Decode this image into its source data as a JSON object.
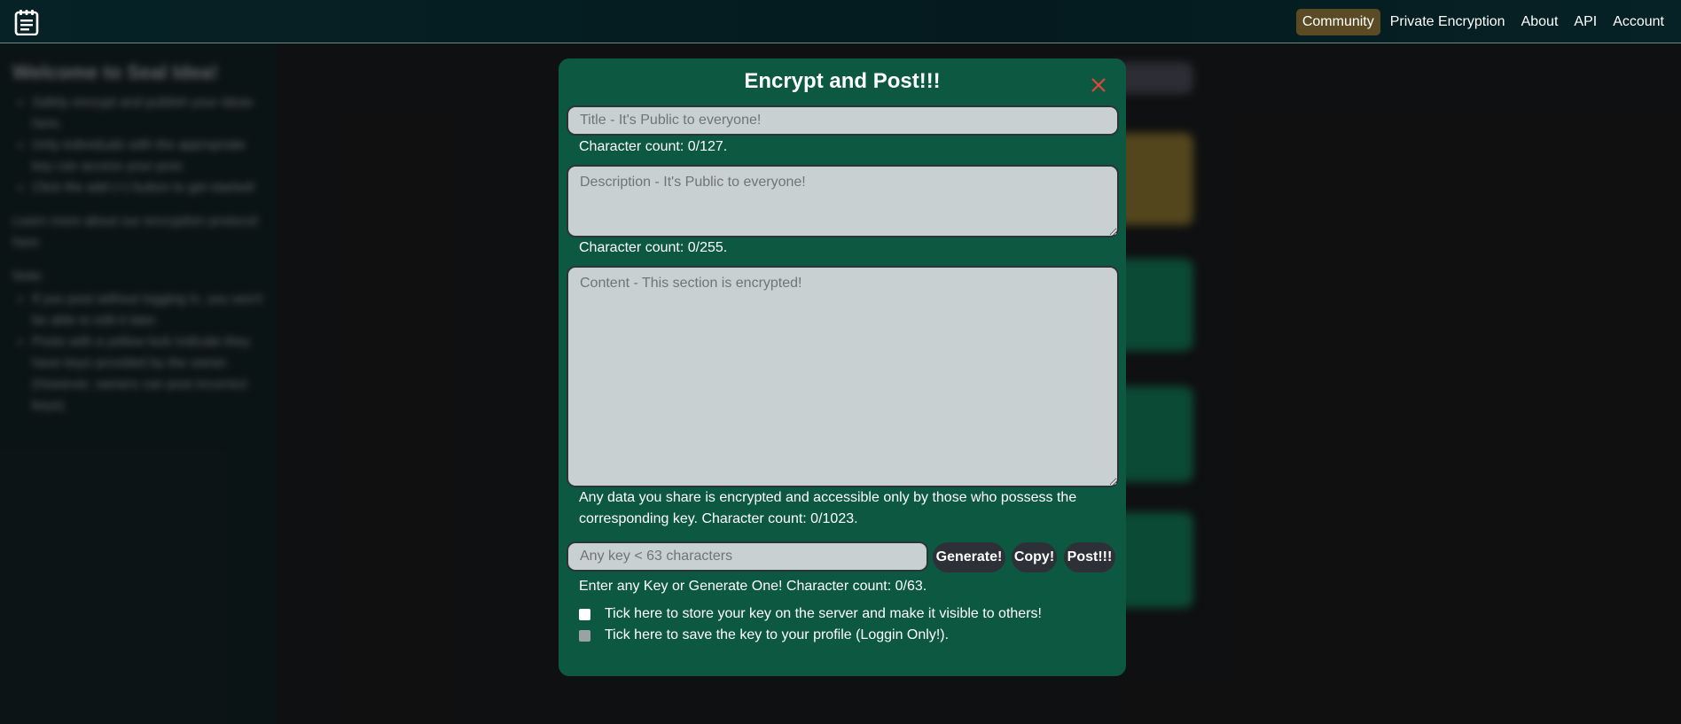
{
  "nav": {
    "links": [
      "Community",
      "Private Encryption",
      "About",
      "API",
      "Account"
    ],
    "active": "Community"
  },
  "sidebar": {
    "heading": "Welcome to Seal Idea!",
    "bullets": [
      "Safely encrypt and publish your ideas here.",
      "Only individuals with the appropriate key can access your post.",
      "Click the add (+) button to get started!"
    ],
    "learn_more": "Learn more about our encryption protocol: here",
    "note_label": "Note:",
    "notes": [
      "If you post without logging in, you won't be able to edit it later.",
      "Posts with a yellow lock indicate they have keys provided by the owner. (However, owners can post incorrect keys).",
      ""
    ]
  },
  "modal": {
    "title": "Encrypt and Post!!!",
    "title_placeholder": "Title - It's Public to everyone!",
    "title_counter": "Character count: 0/127.",
    "desc_placeholder": "Description - It's Public to everyone!",
    "desc_counter": "Character count: 0/255.",
    "content_placeholder": "Content - This section is encrypted!",
    "content_note_line1": "Any data you share is encrypted and accessible only by those who possess the",
    "content_note_line2": "corresponding key. Character count: 0/1023.",
    "key_placeholder": "Any key < 63 characters",
    "generate_label": "Generate!",
    "copy_label": "Copy!",
    "post_label": "Post!!!",
    "key_counter": "Enter any Key or Generate One! Character count: 0/63.",
    "checkbox_store": "Tick here to store your key on the server and make it visible to others!",
    "checkbox_profile": "Tick here to save the key to your profile (Loggin Only!)."
  },
  "colors": {
    "modal_bg": "#0d5841",
    "nav_active": "#5b4b24",
    "close_icon": "#e0463a",
    "button_bg": "#2e3038"
  }
}
